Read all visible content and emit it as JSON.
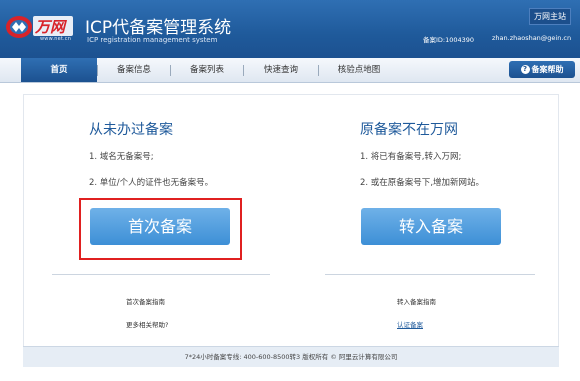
{
  "header": {
    "logo_text": "万网",
    "logo_domain": "www.net.cn",
    "title": "ICP代备案管理系统",
    "subtitle": "ICP registration management system",
    "home_link": "万网主站",
    "record_id": "备案ID:1004390",
    "email": "zhan.zhaoshan@gein.cn"
  },
  "nav": {
    "items": [
      {
        "label": "首页",
        "active": true
      },
      {
        "label": "备案信息",
        "active": false
      },
      {
        "label": "备案列表",
        "active": false
      },
      {
        "label": "快速查询",
        "active": false
      },
      {
        "label": "核验点地图",
        "active": false
      }
    ],
    "help_button": "备案帮助"
  },
  "main": {
    "left": {
      "title": "从未办过备案",
      "line1": "1. 域名无备案号;",
      "line2": "2. 单位/个人的证件也无备案号。",
      "button": "首次备案",
      "link1": "首次备案指南",
      "link2": "更多相关帮助?"
    },
    "right": {
      "title": "原备案不在万网",
      "line1": "1. 将已有备案号,转入万网;",
      "line2": "2. 或在原备案号下,增加新网站。",
      "button": "转入备案",
      "link1": "转入备案指南",
      "link2": "认证备案"
    }
  },
  "footer": {
    "text": "7*24小时备案专线: 400-600-8500转3  版权所有 © 阿里云计算有限公司"
  },
  "colors": {
    "brand_blue": "#1f5a9b",
    "button_blue": "#4a98dc",
    "highlight_red": "#e02020"
  }
}
